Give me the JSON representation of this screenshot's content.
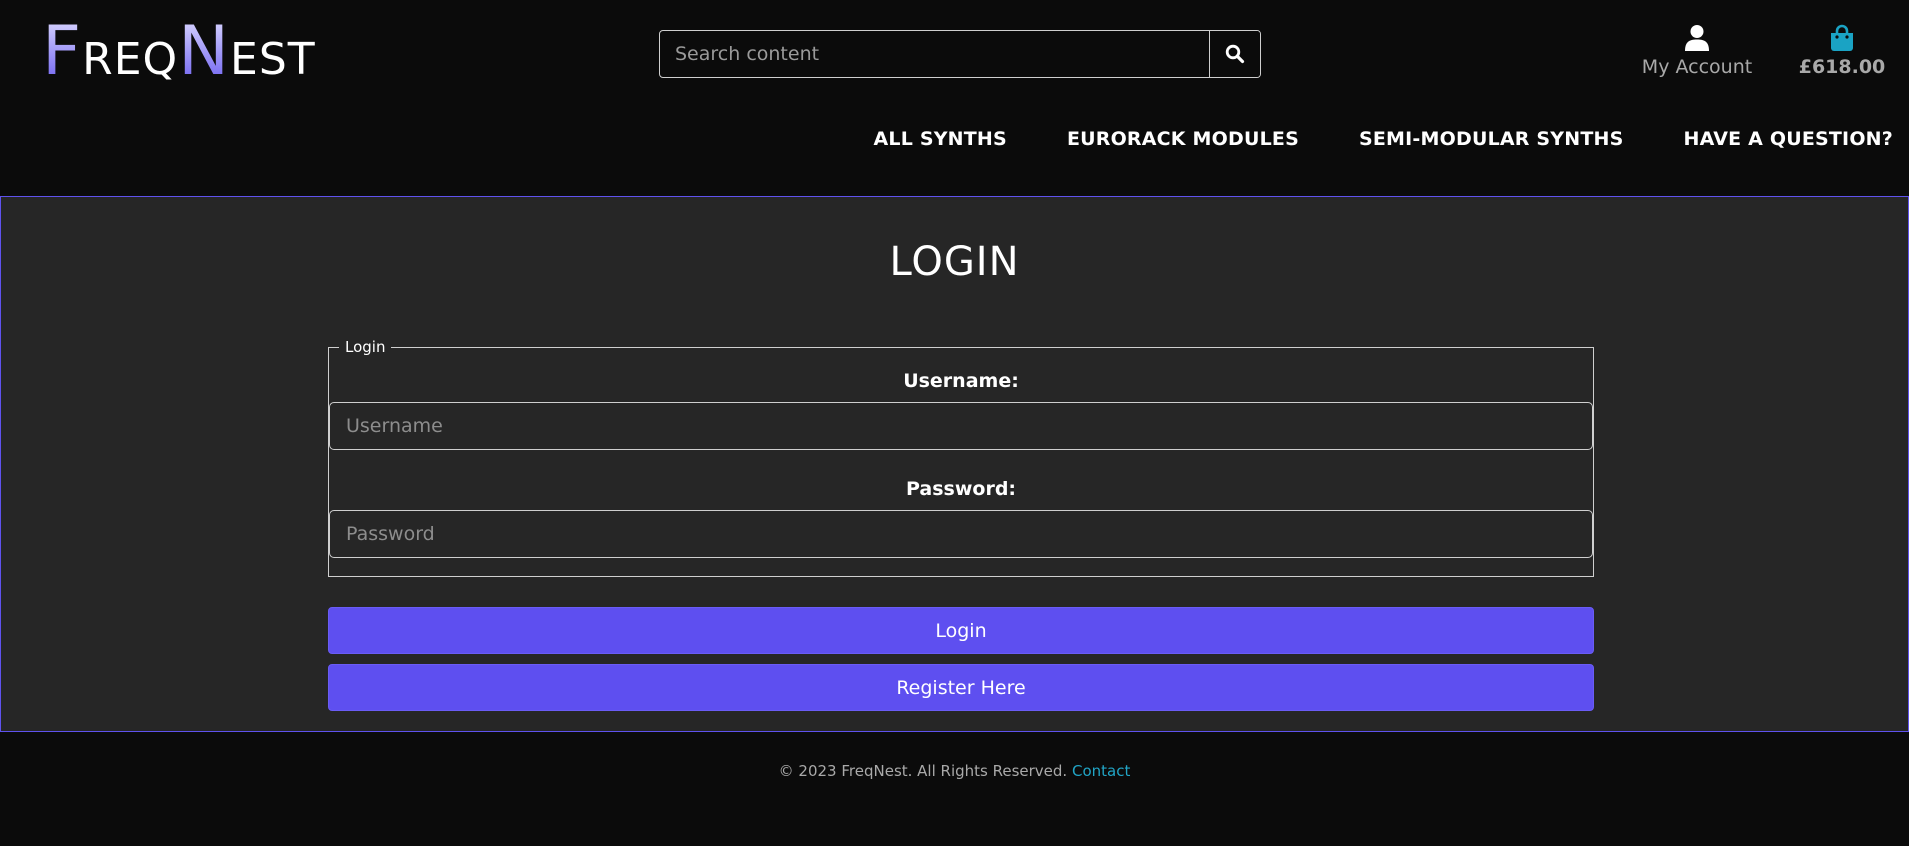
{
  "brand": {
    "parts": [
      {
        "text": "F",
        "style": "big"
      },
      {
        "text": "REQ",
        "style": "small"
      },
      {
        "text": "N",
        "style": "big"
      },
      {
        "text": "EST",
        "style": "small"
      }
    ],
    "gradient_colors": [
      "#d9d6ff",
      "#9c93f7",
      "#6c5ff0"
    ]
  },
  "search": {
    "placeholder": "Search content",
    "button_icon": "search-icon"
  },
  "account": {
    "icon": "user-icon",
    "label": "My Account"
  },
  "basket": {
    "icon": "shopping-bag-icon",
    "icon_color": "#1aa3c4",
    "total": "£618.00"
  },
  "nav": {
    "items": [
      {
        "label": "ALL SYNTHS"
      },
      {
        "label": "EURORACK MODULES"
      },
      {
        "label": "SEMI-MODULAR SYNTHS"
      },
      {
        "label": "HAVE A QUESTION?"
      }
    ]
  },
  "main": {
    "title": "LOGIN",
    "fieldset_legend": "Login",
    "username": {
      "label": "Username:",
      "placeholder": "Username",
      "value": ""
    },
    "password": {
      "label": "Password:",
      "placeholder": "Password",
      "value": ""
    },
    "login_button": "Login",
    "register_button": "Register Here"
  },
  "footer": {
    "text": "© 2023 FreqNest. All Rights Reserved.",
    "contact_link": "Contact"
  },
  "colors": {
    "background": "#0b0b0b",
    "panel": "#262626",
    "accent": "#5e4ff0",
    "link": "#21a5c6"
  }
}
